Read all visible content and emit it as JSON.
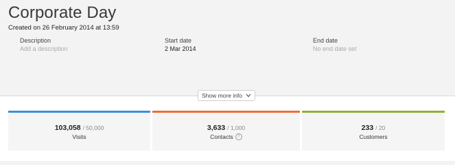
{
  "campaign": {
    "title": "Corporate Day",
    "created": "Created on 26 February 2014 at 13:59"
  },
  "fields": {
    "description": {
      "label": "Description",
      "value": "Add a description"
    },
    "start_date": {
      "label": "Start date",
      "value": "2 Mar 2014"
    },
    "end_date": {
      "label": "End date",
      "value": "No end date set"
    }
  },
  "more_info": {
    "label": "Show more info"
  },
  "stats": [
    {
      "value": "103,058",
      "target": "/ 50,000",
      "label": "Visits",
      "color": "#3b8fdd"
    },
    {
      "value": "3,633",
      "target": "/ 1,000",
      "label": "Contacts",
      "color": "#ef6c36"
    },
    {
      "value": "233",
      "target": "/ 20",
      "label": "Customers",
      "color": "#8cb233"
    }
  ],
  "icons": {
    "more_info_icon": "chevron-down-icon",
    "contacts_info_icon": "help-icon"
  }
}
